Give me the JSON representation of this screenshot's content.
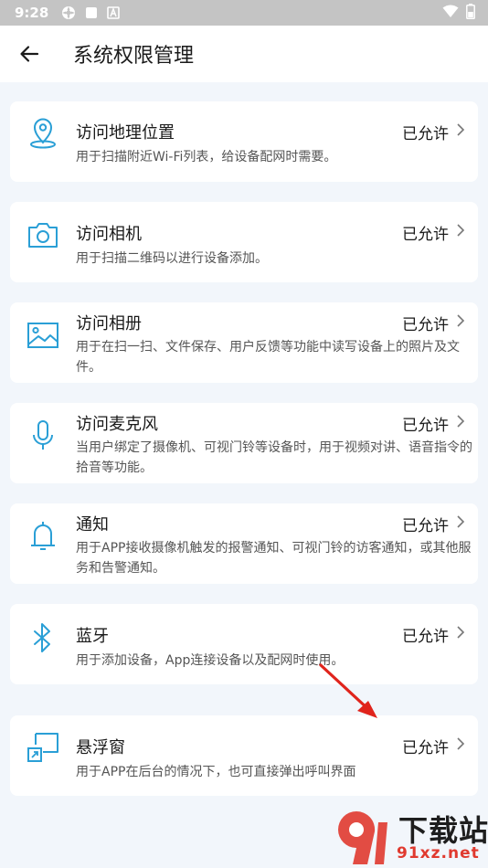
{
  "status_bar": {
    "time": "9:28",
    "icons": [
      "settings-flower-icon",
      "square-icon",
      "a-box-icon",
      "wifi-icon",
      "battery-icon"
    ]
  },
  "header": {
    "title": "系统权限管理",
    "back_icon": "arrow-left-icon"
  },
  "permissions": [
    {
      "title": "访问地理位置",
      "status": "已允许",
      "desc": "用于扫描附近Wi-Fi列表，给设备配网时需要。",
      "icon": "location-pin-icon"
    },
    {
      "title": "访问相机",
      "status": "已允许",
      "desc": "用于扫描二维码以进行设备添加。",
      "icon": "camera-icon"
    },
    {
      "title": "访问相册",
      "status": "已允许",
      "desc": "用于在扫一扫、文件保存、用户反馈等功能中读写设备上的照片及文件。",
      "icon": "image-icon"
    },
    {
      "title": "访问麦克风",
      "status": "已允许",
      "desc": "当用户绑定了摄像机、可视门铃等设备时，用于视频对讲、语音指令的拾音等功能。",
      "icon": "microphone-icon"
    },
    {
      "title": "通知",
      "status": "已允许",
      "desc": "用于APP接收摄像机触发的报警通知、可视门铃的访客通知，或其他服务和告警通知。",
      "icon": "bell-icon"
    },
    {
      "title": "蓝牙",
      "status": "已允许",
      "desc": "用于添加设备，App连接设备以及配网时使用。",
      "icon": "bluetooth-icon"
    },
    {
      "title": "悬浮窗",
      "status": "已允许",
      "desc": "用于APP在后台的情况下，也可直接弹出呼叫界面",
      "icon": "floating-window-icon"
    }
  ],
  "watermark": {
    "line1": "下载站",
    "line2": "91xz.net"
  },
  "colors": {
    "accent": "#2a9fd6",
    "background": "#f2f6fb",
    "card": "#ffffff",
    "arrow": "#e0241c"
  }
}
